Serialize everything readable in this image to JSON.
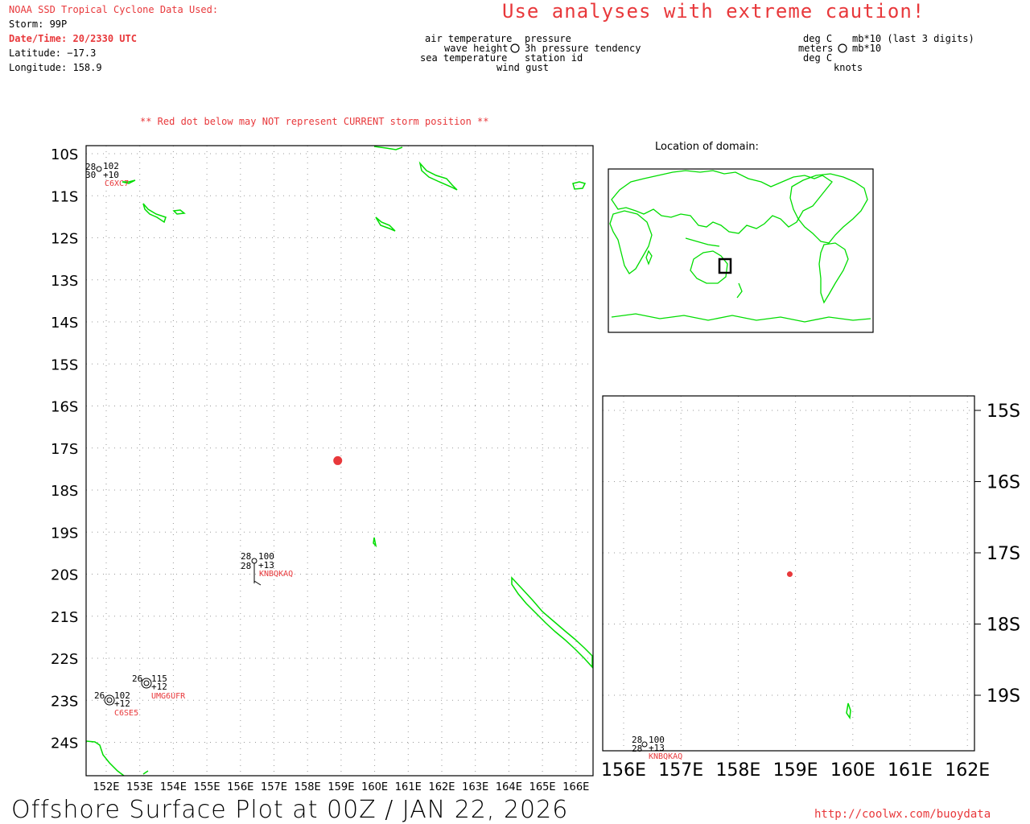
{
  "header": {
    "source_title": "NOAA SSD Tropical Cyclone Data Used:",
    "storm": "Storm: 99P",
    "datetime": "Date/Time: 20/2330 UTC",
    "latitude": "Latitude: −17.3",
    "longitude": "Longitude: 158.9",
    "caution": "Use analyses with extreme caution!"
  },
  "legend": {
    "left_labels": [
      "air temperature",
      "wave height",
      "sea temperature"
    ],
    "right_labels": [
      "pressure",
      "3h pressure tendency",
      "station id"
    ],
    "bottom_label": "wind gust",
    "units_left": [
      "deg C",
      "meters",
      "deg C"
    ],
    "units_right": [
      "mb*10 (last 3 digits)",
      "mb*10"
    ],
    "units_bottom": "knots"
  },
  "notice": "** Red dot below may NOT represent CURRENT storm position **",
  "main_map": {
    "lat_labels": [
      "10S",
      "11S",
      "12S",
      "13S",
      "14S",
      "15S",
      "16S",
      "17S",
      "18S",
      "19S",
      "20S",
      "21S",
      "22S",
      "23S",
      "24S"
    ],
    "lon_labels": [
      "152E",
      "153E",
      "154E",
      "155E",
      "156E",
      "157E",
      "158E",
      "159E",
      "160E",
      "161E",
      "162E",
      "163E",
      "164E",
      "165E",
      "166E"
    ],
    "storm_position": {
      "lat": -17.3,
      "lon": 158.9
    },
    "stations": [
      {
        "id": "C6XC7",
        "air_temp": "28",
        "sea_temp": "30",
        "pressure": "102",
        "tendency": "+10"
      },
      {
        "id": "KNBQKAQ",
        "air_temp": "28",
        "sea_temp": "28",
        "pressure": "100",
        "tendency": "+13"
      },
      {
        "id": "UMG6UFR",
        "air_temp": "26",
        "pressure": "115",
        "tendency": "+12"
      },
      {
        "id": "C6SE5",
        "air_temp": "26",
        "pressure": "102",
        "tendency": "+12"
      }
    ]
  },
  "locator": {
    "title": "Location of domain:"
  },
  "zoom_map": {
    "lat_labels": [
      "15S",
      "16S",
      "17S",
      "18S",
      "19S"
    ],
    "lon_labels": [
      "156E",
      "157E",
      "158E",
      "159E",
      "160E",
      "161E",
      "162E"
    ],
    "station": {
      "id": "KNBQKAQ",
      "air_temp": "28",
      "sea_temp": "28",
      "pressure": "100",
      "tendency": "+13"
    }
  },
  "footer": {
    "title": "Offshore Surface Plot at 00Z / JAN 22, 2026",
    "url": "http://coolwx.com/buoydata"
  },
  "colors": {
    "land": "#00dd00",
    "accent_red": "#e8383b",
    "grid": "#999999"
  }
}
